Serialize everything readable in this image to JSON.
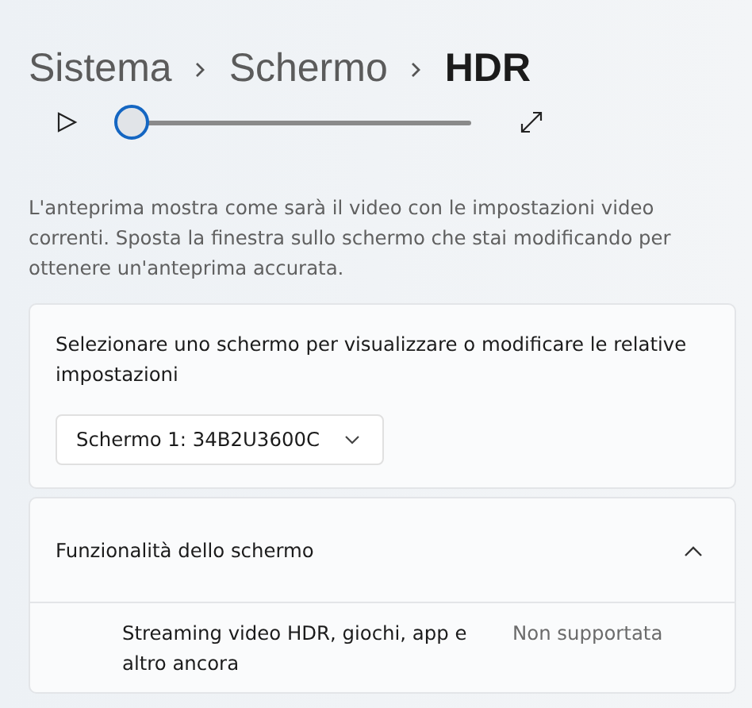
{
  "breadcrumb": [
    {
      "label": "Sistema",
      "selected": false
    },
    {
      "label": "Schermo",
      "selected": false
    },
    {
      "label": "HDR",
      "selected": true
    }
  ],
  "player": {
    "level": 0
  },
  "description": "L'anteprima mostra come sarà il video con le impostazioni video correnti. Sposta la finestra sullo schermo che stai modificando per ottenere un'anteprima accurata.",
  "display_card": {
    "label": "Selezionare uno schermo per visualizzare o modificare le relative impostazioni",
    "dropdown": {
      "value": "Schermo 1: 34B2U3600C"
    }
  },
  "features": {
    "title": "Funzionalità dello schermo",
    "expanded": true,
    "rows": [
      {
        "label": "Streaming video HDR, giochi, app e altro ancora",
        "value": "Non supportata"
      }
    ]
  }
}
